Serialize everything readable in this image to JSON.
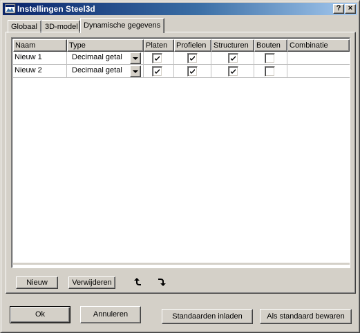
{
  "window": {
    "title": "Instellingen Steel3d",
    "help_label": "?",
    "close_label": "×"
  },
  "tabs": [
    {
      "label": "Globaal",
      "active": false
    },
    {
      "label": "3D-model",
      "active": false
    },
    {
      "label": "Dynamische gegevens",
      "active": true
    }
  ],
  "grid": {
    "columns": [
      "Naam",
      "Type",
      "Platen",
      "Profielen",
      "Structuren",
      "Bouten",
      "Combinatie"
    ],
    "rows": [
      {
        "naam": "Nieuw 1",
        "type": "Decimaal getal",
        "platen": true,
        "profielen": true,
        "structuren": true,
        "bouten": false,
        "combinatie": ""
      },
      {
        "naam": "Nieuw 2",
        "type": "Decimaal getal",
        "platen": true,
        "profielen": true,
        "structuren": true,
        "bouten": false,
        "combinatie": ""
      }
    ]
  },
  "panel_buttons": {
    "new_label": "Nieuw",
    "delete_label": "Verwijderen",
    "move_up_icon": "arrow-up-icon",
    "move_down_icon": "arrow-down-icon"
  },
  "dialog_buttons": {
    "ok_label": "Ok",
    "cancel_label": "Annuleren",
    "load_defaults_label": "Standaarden inladen",
    "save_default_label": "Als standaard bewaren"
  },
  "colors": {
    "face": "#d4d0c8",
    "title_start": "#0a246a",
    "title_end": "#a6caf0"
  }
}
